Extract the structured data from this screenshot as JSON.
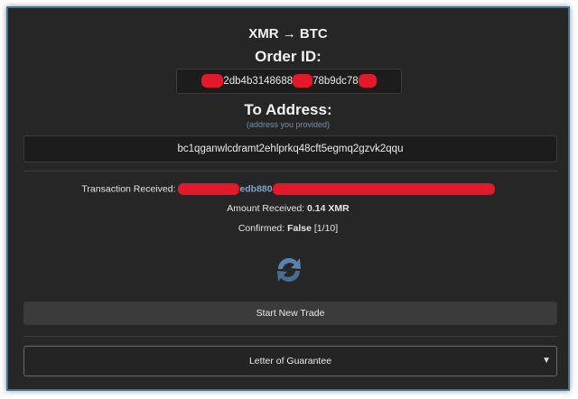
{
  "header": {
    "pair": "XMR → BTC",
    "order_id_label": "Order ID:"
  },
  "order": {
    "id_visible_1": "2db4b3148688",
    "id_visible_2": "78b9dc78"
  },
  "to_address": {
    "label": "To Address:",
    "note": "(address you provided)",
    "value": "bc1qganwlcdramt2ehlprkq48cft5egmq2gzvk2qqu"
  },
  "status": {
    "tx_label": "Transaction Received:",
    "tx_hash_visible": "edb880",
    "amount_label": "Amount Received:",
    "amount_value": "0.14 XMR",
    "confirmed_label": "Confirmed:",
    "confirmed_value": "False",
    "confirmed_count": "[1/10]"
  },
  "actions": {
    "new_trade_label": "Start New Trade"
  },
  "guarantee": {
    "selected": "Letter of Guarantee"
  },
  "icons": {
    "refresh": "refresh-icon",
    "caret": "triangle-down-icon"
  },
  "colors": {
    "accent": "#7fa3cf",
    "redaction": "#e3182a",
    "panel": "#262626"
  }
}
